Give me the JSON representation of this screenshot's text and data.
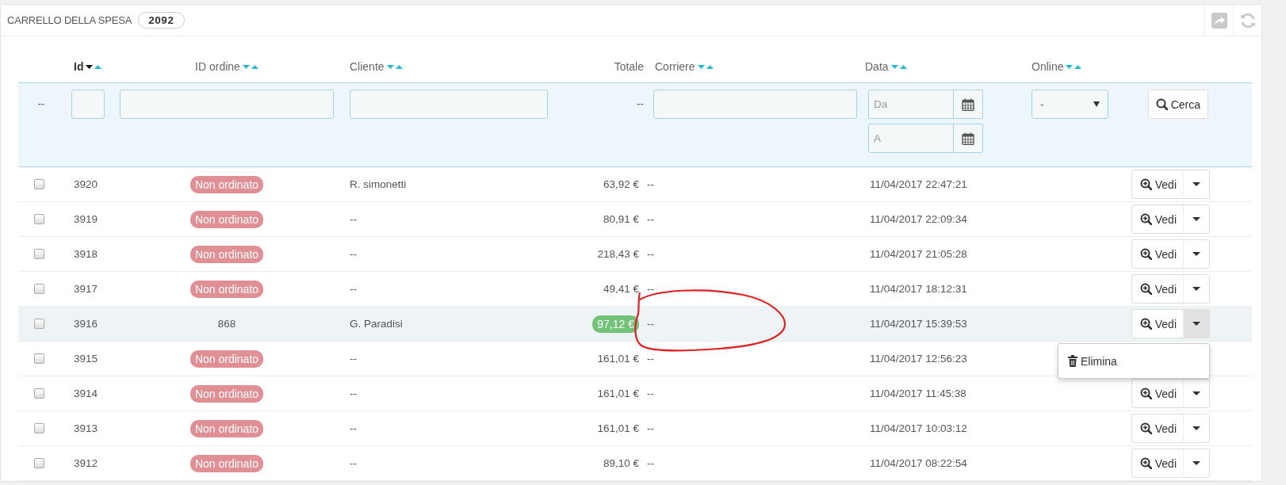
{
  "panel": {
    "title": "CARRELLO DELLA SPESA",
    "count": "2092"
  },
  "columns": [
    {
      "label": "Id",
      "sortable": true,
      "sorted_desc": true
    },
    {
      "label": "ID ordine",
      "sortable": true,
      "sorted_desc": false
    },
    {
      "label": "Cliente",
      "sortable": true,
      "sorted_desc": false
    },
    {
      "label": "Totale",
      "sortable": false
    },
    {
      "label": "Corriere",
      "sortable": true,
      "sorted_desc": false
    },
    {
      "label": "Data",
      "sortable": true,
      "sorted_desc": false
    },
    {
      "label": "Online",
      "sortable": true,
      "sorted_desc": false
    }
  ],
  "filters": {
    "bulk": "--",
    "totale": "--",
    "date_from": {
      "placeholder": "Da"
    },
    "date_to": {
      "placeholder": "A"
    },
    "online": {
      "value": "-"
    },
    "search_button": "Cerca"
  },
  "rows": [
    {
      "checked": false,
      "id": "3920",
      "order": {
        "kind": "badge",
        "text": "Non ordinato"
      },
      "cliente": "R. simonetti",
      "totale": "63,92 €",
      "paid": false,
      "corriere": "--",
      "data": "11/04/2017 22:47:21",
      "hover": false,
      "action": "Vedi",
      "expanded": false
    },
    {
      "checked": false,
      "id": "3919",
      "order": {
        "kind": "badge",
        "text": "Non ordinato"
      },
      "cliente": "--",
      "totale": "80,91 €",
      "paid": false,
      "corriere": "--",
      "data": "11/04/2017 22:09:34",
      "hover": false,
      "action": "Vedi",
      "expanded": false
    },
    {
      "checked": false,
      "id": "3918",
      "order": {
        "kind": "badge",
        "text": "Non ordinato"
      },
      "cliente": "--",
      "totale": "218,43 €",
      "paid": false,
      "corriere": "--",
      "data": "11/04/2017 21:05:28",
      "hover": false,
      "action": "Vedi",
      "expanded": false
    },
    {
      "checked": false,
      "id": "3917",
      "order": {
        "kind": "badge",
        "text": "Non ordinato"
      },
      "cliente": "--",
      "totale": "49,41 €",
      "paid": false,
      "corriere": "--",
      "data": "11/04/2017 18:12:31",
      "hover": false,
      "action": "Vedi",
      "expanded": false
    },
    {
      "checked": false,
      "id": "3916",
      "order": {
        "kind": "text",
        "text": "868"
      },
      "cliente": "G. Paradisi",
      "totale": "97,12 €",
      "paid": true,
      "corriere": "--",
      "data": "11/04/2017 15:39:53",
      "hover": true,
      "action": "Vedi",
      "expanded": true,
      "menu": [
        {
          "label": "Elimina"
        }
      ]
    },
    {
      "checked": false,
      "id": "3915",
      "order": {
        "kind": "badge",
        "text": "Non ordinato"
      },
      "cliente": "--",
      "totale": "161,01 €",
      "paid": false,
      "corriere": "--",
      "data": "11/04/2017 12:56:23",
      "hover": false
    },
    {
      "checked": false,
      "id": "3914",
      "order": {
        "kind": "badge",
        "text": "Non ordinato"
      },
      "cliente": "--",
      "totale": "161,01 €",
      "paid": false,
      "corriere": "--",
      "data": "11/04/2017 11:45:38",
      "hover": false,
      "action": "Vedi",
      "expanded": false
    },
    {
      "checked": false,
      "id": "3913",
      "order": {
        "kind": "badge",
        "text": "Non ordinato"
      },
      "cliente": "--",
      "totale": "161,01 €",
      "paid": false,
      "corriere": "--",
      "data": "11/04/2017 10:03:12",
      "hover": false,
      "action": "Vedi",
      "expanded": false
    },
    {
      "checked": false,
      "id": "3912",
      "order": {
        "kind": "badge",
        "text": "Non ordinato"
      },
      "cliente": "--",
      "totale": "89,10 €",
      "paid": false,
      "corriere": "--",
      "data": "11/04/2017 08:22:54",
      "hover": false,
      "action": "Vedi",
      "expanded": false
    }
  ],
  "annotations": [
    {
      "kind": "freehand-circle"
    }
  ]
}
